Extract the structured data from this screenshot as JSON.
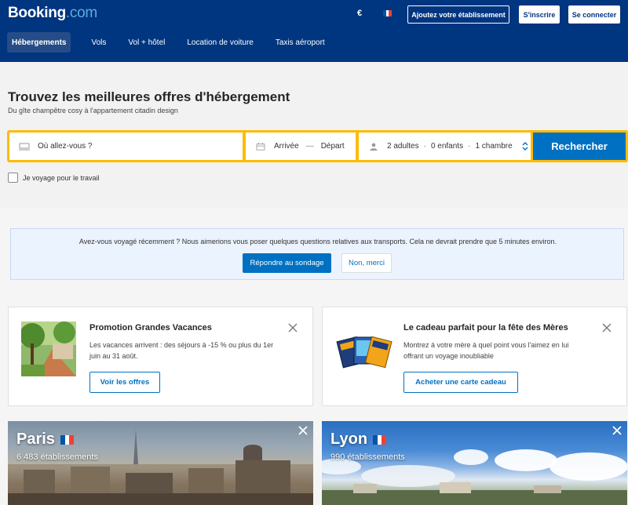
{
  "header": {
    "logo_main": "Booking",
    "logo_suffix": ".com",
    "currency": "€",
    "list_property": "Ajoutez votre établissement",
    "signup": "S'inscrire",
    "login": "Se connecter",
    "nav": [
      {
        "label": "Hébergements",
        "active": true
      },
      {
        "label": "Vols"
      },
      {
        "label": "Vol + hôtel"
      },
      {
        "label": "Location de voiture"
      },
      {
        "label": "Taxis aéroport"
      }
    ]
  },
  "search": {
    "title": "Trouvez les meilleures offres d'hébergement",
    "subtitle": "Du gîte champêtre cosy à l'appartement citadin design",
    "destination_placeholder": "Où allez-vous ?",
    "checkin": "Arrivée",
    "dash": "—",
    "checkout": "Départ",
    "adults": "2 adultes",
    "children": "0 enfants",
    "rooms": "1 chambre",
    "dot": "·",
    "button": "Rechercher",
    "work_travel": "Je voyage pour le travail"
  },
  "survey": {
    "text": "Avez-vous voyagé récemment ? Nous aimerions vous poser quelques questions relatives aux transports. Cela ne devrait prendre que 5 minutes environ.",
    "answer": "Répondre au sondage",
    "decline": "Non, merci"
  },
  "promos": [
    {
      "title": "Promotion Grandes Vacances",
      "desc_line1": "Les vacances arrivent : des séjours à -15 % ou plus du 1er",
      "desc_line2": "juin au 31 août.",
      "button": "Voir les offres"
    },
    {
      "title": "Le cadeau parfait pour la fête des Mères",
      "desc_line1": "Montrez à votre mère à quel point vous l'aimez en lui",
      "desc_line2": "offrant un voyage inoubliable",
      "button": "Acheter une carte cadeau"
    }
  ],
  "cities": [
    {
      "name": "Paris",
      "count": "6 483 établissements"
    },
    {
      "name": "Lyon",
      "count": "990 établissements"
    }
  ],
  "colors": {
    "brand_navy": "#003580",
    "brand_blue": "#0071c2",
    "search_yellow": "#febb02"
  }
}
